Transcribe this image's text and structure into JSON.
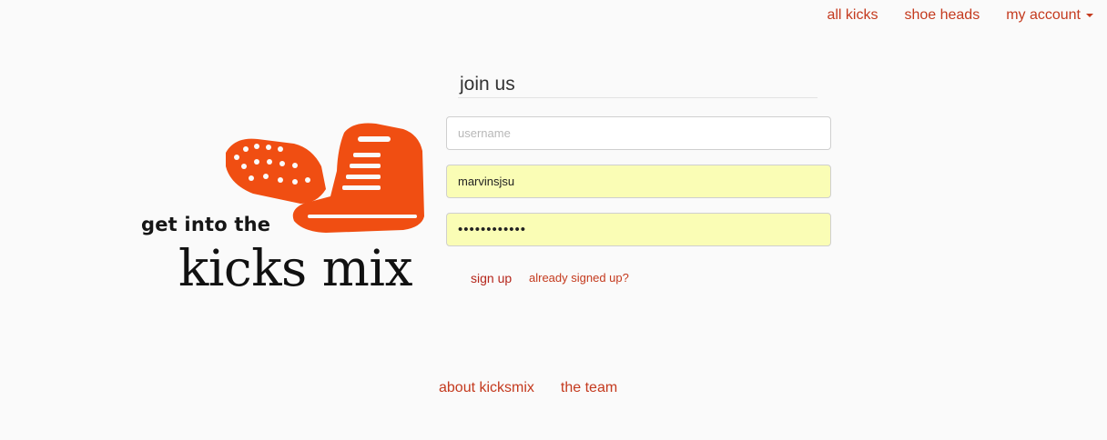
{
  "nav": {
    "all_kicks": "all kicks",
    "shoe_heads": "shoe heads",
    "my_account": "my account"
  },
  "logo": {
    "tagline": "get into the",
    "name": "kicks mix",
    "icon": "boot-icon",
    "color": "#f04e12"
  },
  "form": {
    "title": "join us",
    "username": {
      "placeholder": "username",
      "value": ""
    },
    "second_field": {
      "value": "marvinsjsu"
    },
    "password": {
      "value": "••••••••••••"
    },
    "signup_label": "sign up",
    "already_label": "already signed up?"
  },
  "footer": {
    "about": "about kicksmix",
    "team": "the team"
  },
  "colors": {
    "accent": "#c43a1e",
    "autofill": "#fafdb5",
    "background": "#fafafa"
  }
}
